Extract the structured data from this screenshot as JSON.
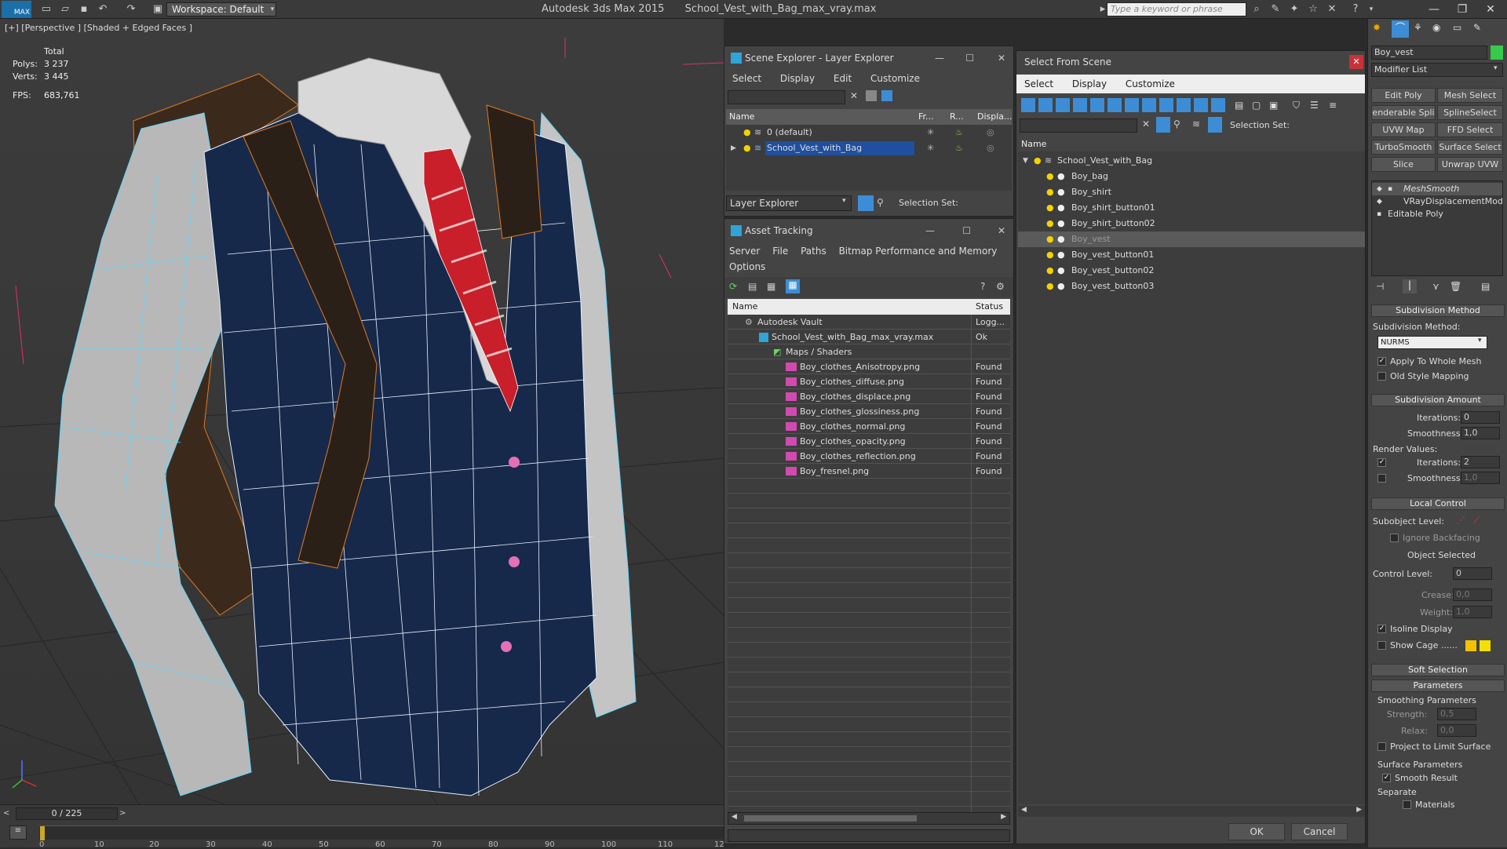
{
  "titlebar": {
    "logo": "MAX",
    "workspace": "Workspace: Default",
    "app_name": "Autodesk 3ds Max  2015",
    "file_name": "School_Vest_with_Bag_max_vray.max",
    "search_placeholder": "Type a keyword or phrase"
  },
  "viewport": {
    "label": "[+] [Perspective ] [Shaded + Edged Faces ]",
    "stats": {
      "total_label": "Total",
      "polys_label": "Polys:",
      "polys": "3 237",
      "verts_label": "Verts:",
      "verts": "3 445",
      "fps_label": "FPS:",
      "fps": "683,761"
    }
  },
  "timeline": {
    "frame": "0 / 225",
    "ticks": [
      "0",
      "10",
      "20",
      "30",
      "40",
      "50",
      "60",
      "70",
      "80",
      "90",
      "100",
      "110",
      "12"
    ]
  },
  "scene_explorer": {
    "title": "Scene Explorer - Layer Explorer",
    "menu": [
      "Select",
      "Display",
      "Edit",
      "Customize"
    ],
    "columns": [
      "Name",
      "Fr...",
      "R...",
      "Displa..."
    ],
    "layers": [
      "0 (default)",
      "School_Vest_with_Bag"
    ],
    "footer_dropdown": "Layer Explorer",
    "selection_set_label": "Selection Set:"
  },
  "asset_tracking": {
    "title": "Asset Tracking",
    "menu": [
      "Server",
      "File",
      "Paths",
      "Bitmap Performance and Memory"
    ],
    "menu2": "Options",
    "columns": [
      "Name",
      "Status"
    ],
    "rows": [
      {
        "name": "Autodesk Vault",
        "status": "Logg..."
      },
      {
        "name": "School_Vest_with_Bag_max_vray.max",
        "status": "Ok"
      },
      {
        "name": "Maps / Shaders",
        "status": ""
      },
      {
        "name": "Boy_clothes_Anisotropy.png",
        "status": "Found"
      },
      {
        "name": "Boy_clothes_diffuse.png",
        "status": "Found"
      },
      {
        "name": "Boy_clothes_displace.png",
        "status": "Found"
      },
      {
        "name": "Boy_clothes_glossiness.png",
        "status": "Found"
      },
      {
        "name": "Boy_clothes_normal.png",
        "status": "Found"
      },
      {
        "name": "Boy_clothes_opacity.png",
        "status": "Found"
      },
      {
        "name": "Boy_clothes_reflection.png",
        "status": "Found"
      },
      {
        "name": "Boy_fresnel.png",
        "status": "Found"
      }
    ]
  },
  "select_from_scene": {
    "title": "Select From Scene",
    "menu": [
      "Select",
      "Display",
      "Customize"
    ],
    "selection_set_label": "Selection Set:",
    "column": "Name",
    "root": "School_Vest_with_Bag",
    "items": [
      "Boy_bag",
      "Boy_shirt",
      "Boy_shirt_button01",
      "Boy_shirt_button02",
      "Boy_vest",
      "Boy_vest_button01",
      "Boy_vest_button02",
      "Boy_vest_button03"
    ],
    "selected": "Boy_vest",
    "ok": "OK",
    "cancel": "Cancel"
  },
  "command_panel": {
    "object_name": "Boy_vest",
    "modifier_list": "Modifier List",
    "buttons": [
      "Edit Poly",
      "Mesh Select",
      "enderable Spli",
      "SplineSelect",
      "UVW Map",
      "FFD Select",
      "TurboSmooth",
      "Surface Select",
      "Slice",
      "Unwrap UVW"
    ],
    "stack": [
      "MeshSmooth",
      "VRayDisplacementMod",
      "Editable Poly"
    ],
    "subdivision_method_title": "Subdivision Method",
    "subdivision_method_label": "Subdivision Method:",
    "subdivision_method_value": "NURMS",
    "apply_whole_mesh": "Apply To Whole Mesh",
    "old_style_mapping": "Old Style Mapping",
    "subdivision_amount_title": "Subdivision Amount",
    "iterations_label": "Iterations:",
    "iterations": "0",
    "smoothness_label": "Smoothness:",
    "smoothness": "1,0",
    "render_values": "Render Values:",
    "render_iterations": "2",
    "render_smoothness": "1,0",
    "local_control_title": "Local Control",
    "subobject_level": "Subobject Level:",
    "ignore_backfacing": "Ignore Backfacing",
    "object_selected": "Object Selected",
    "control_level_label": "Control Level:",
    "control_level": "0",
    "crease_label": "Crease:",
    "crease": "0,0",
    "weight_label": "Weight:",
    "weight": "1,0",
    "isoline_display": "Isoline Display",
    "show_cage": "Show Cage ......",
    "soft_selection_title": "Soft Selection",
    "parameters_title": "Parameters",
    "smoothing_parameters": "Smoothing Parameters",
    "strength_label": "Strength:",
    "strength": "0,5",
    "relax_label": "Relax:",
    "relax": "0,0",
    "project_limit": "Project to Limit Surface",
    "surface_parameters": "Surface Parameters",
    "smooth_result": "Smooth Result",
    "separate": "Separate",
    "materials": "Materials"
  },
  "colors": {
    "selection_blue": "#1f4f9e",
    "cage_yellow": "#f2c200",
    "wire_cyan": "#5fd8ff",
    "wire_orange": "#e07a1f"
  }
}
